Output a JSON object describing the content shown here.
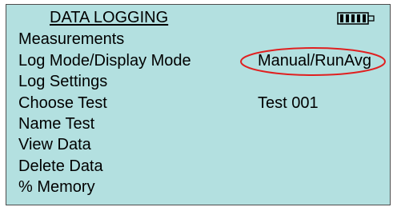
{
  "header": {
    "title": "DATA LOGGING",
    "battery_icon": "battery-icon"
  },
  "menu": {
    "items": [
      {
        "label": "Measurements",
        "value": ""
      },
      {
        "label": "Log Mode/Display Mode",
        "value": "Manual/RunAvg"
      },
      {
        "label": "Log Settings",
        "value": ""
      },
      {
        "label": "Choose Test",
        "value": "Test 001"
      },
      {
        "label": "Name Test",
        "value": ""
      },
      {
        "label": "View Data",
        "value": ""
      },
      {
        "label": "Delete Data",
        "value": ""
      },
      {
        "label": "% Memory",
        "value": ""
      }
    ]
  },
  "colors": {
    "screen_background": "#b3e0e0",
    "highlight_circle": "#e02020"
  }
}
